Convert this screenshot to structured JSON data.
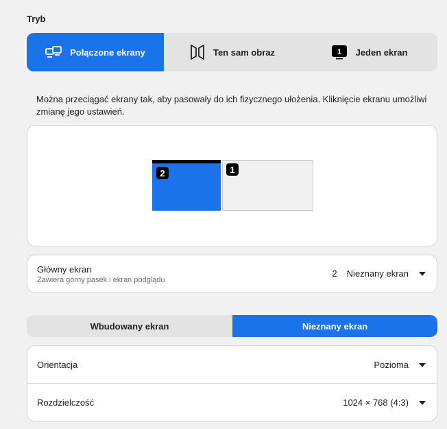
{
  "section": {
    "title": "Tryb"
  },
  "modes": [
    {
      "label": "Połączone ekrany",
      "icon": "joined-displays-icon",
      "active": true
    },
    {
      "label": "Ten sam obraz",
      "icon": "mirror-icon",
      "active": false
    },
    {
      "label": "Jeden ekran",
      "icon": "single-display-icon",
      "badge": "1",
      "active": false
    }
  ],
  "description": "Można przeciągać ekrany tak, aby pasowały do ich fizycznego ułożenia. Kliknięcie ekranu umożliwi zmianę jego ustawień.",
  "arrangement": {
    "displays": [
      {
        "badge": "2",
        "selected": true
      },
      {
        "badge": "1",
        "selected": false
      }
    ]
  },
  "main_display": {
    "title": "Główny ekran",
    "subtitle": "Zawiera górny pasek i ekran podglądu",
    "selected_number": "2",
    "selected_name": "Nieznany ekran"
  },
  "display_tabs": [
    {
      "label": "Wbudowany ekran",
      "active": false
    },
    {
      "label": "Nieznany ekran",
      "active": true
    }
  ],
  "settings": {
    "orientation": {
      "label": "Orientacja",
      "value": "Pozioma"
    },
    "resolution": {
      "label": "Rozdzielczość",
      "value": "1024 × 768 (4:3)"
    }
  },
  "colors": {
    "accent": "#1a73e8",
    "background": "#f1f1f1",
    "card": "#ffffff"
  }
}
